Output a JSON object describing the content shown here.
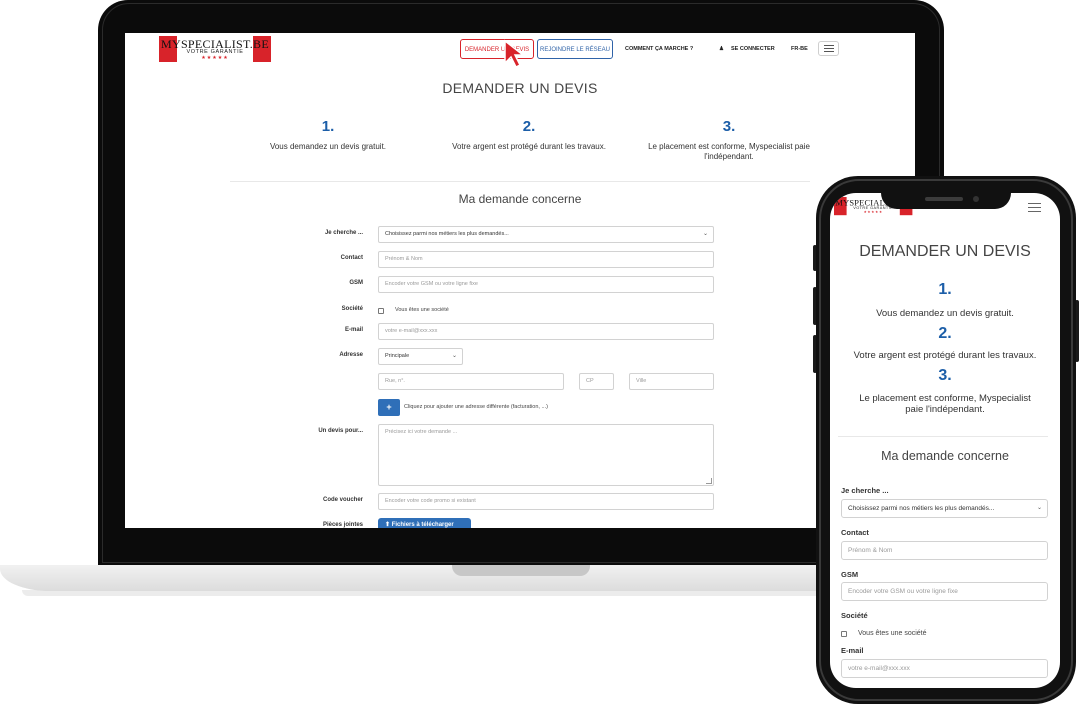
{
  "brand": {
    "logo_main": "MYSPECIALIST.BE",
    "logo_tagline": "VOTRE GARANTIE",
    "logo_stars": "★★★★★",
    "accent_red": "#d8232a",
    "accent_blue": "#1c5ea8"
  },
  "nav": {
    "request_quote": "DEMANDER UN DEVIS",
    "join_network": "REJOINDRE LE RÉSEAU",
    "how_it_works": "COMMENT ÇA MARCHE ?",
    "login": "SE CONNECTER",
    "language": "FR-BE"
  },
  "page": {
    "title": "DEMANDER UN DEVIS",
    "steps": [
      {
        "num": "1.",
        "text": "Vous demandez un devis gratuit."
      },
      {
        "num": "2.",
        "text": "Votre argent est protégé durant les travaux."
      },
      {
        "num": "3.",
        "text": "Le placement est conforme, Myspecialist paie l'indépendant."
      }
    ],
    "section_title": "Ma demande concerne"
  },
  "form": {
    "search_label": "Je cherche ...",
    "search_value": "Choisissez parmi nos métiers les plus demandés...",
    "contact_label": "Contact",
    "contact_placeholder": "Prénom & Nom",
    "gsm_label": "GSM",
    "gsm_placeholder": "Encoder votre GSM ou votre ligne fixe",
    "company_label": "Société",
    "company_checkbox": "Vous êtes une société",
    "email_label": "E-mail",
    "email_placeholder": "votre e-mail@xxx.xxx",
    "address_label": "Adresse",
    "address_type": "Principale",
    "street_placeholder": "Rue, n°.",
    "zip_placeholder": "CP",
    "city_placeholder": "Ville",
    "add_address_symbol": "+",
    "add_address_text": "Cliquez pour ajouter une adresse différente (facturation, ...)",
    "quote_label": "Un devis pour...",
    "quote_placeholder": "Précisez ici votre demande ...",
    "voucher_label": "Code voucher",
    "voucher_placeholder": "Encoder votre code promo si existant",
    "attachments_label": "Pièces jointes",
    "upload_button": "Fichiers à télécharger"
  }
}
